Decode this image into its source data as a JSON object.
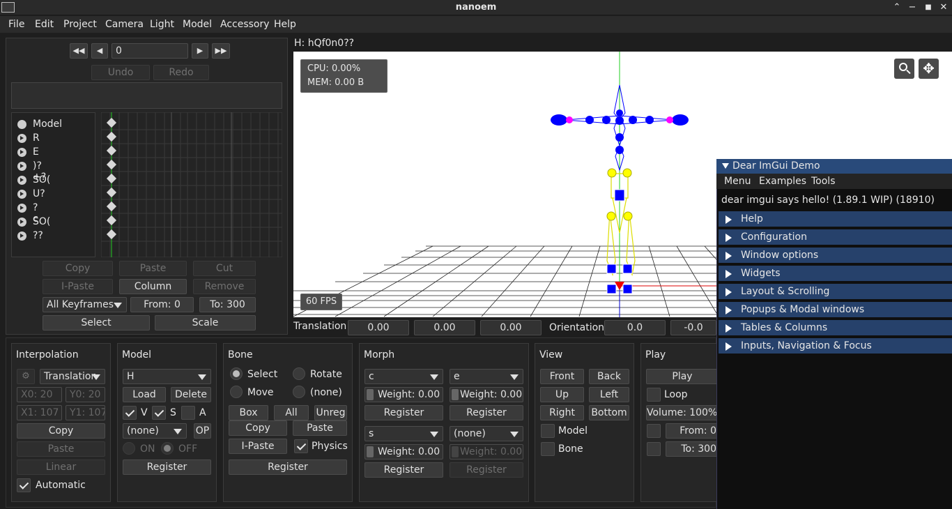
{
  "window": {
    "title": "nanoem",
    "minimize": "−",
    "maximize": "■",
    "close": "✕",
    "collapse": "⌃"
  },
  "menu": [
    "File",
    "Edit",
    "Project",
    "Camera",
    "Light",
    "Model",
    "Accessory",
    "Help"
  ],
  "timeline": {
    "frame_value": "0",
    "undo": "Undo",
    "redo": "Redo",
    "tracks": [
      {
        "label": "Model",
        "kind": "dot"
      },
      {
        "label": "R",
        "kind": "arrow"
      },
      {
        "label": "E",
        "kind": "arrow"
      },
      {
        "label": ")?+?",
        "kind": "arrow"
      },
      {
        "label": "SO(",
        "kind": "arrow"
      },
      {
        "label": "U?",
        "kind": "arrow"
      },
      {
        "label": "?c",
        "kind": "arrow"
      },
      {
        "label": "SO(",
        "kind": "arrow"
      },
      {
        "label": "??",
        "kind": "arrow"
      }
    ],
    "copy": "Copy",
    "paste": "Paste",
    "cut": "Cut",
    "ipaste": "I-Paste",
    "column": "Column",
    "remove": "Remove",
    "keyframes_select": "All Keyframes",
    "from": "From: 0",
    "to": "To: 300",
    "select": "Select",
    "scale": "Scale"
  },
  "viewport": {
    "header": "H: hQf0n0??",
    "cpu": "CPU: 0.00%",
    "mem": "MEM: 0.00 B",
    "fps": "60 FPS",
    "translation_label": "Translation",
    "translation": [
      "0.00",
      "0.00",
      "0.00"
    ],
    "orientation_label": "Orientation",
    "orientation": [
      "0.0",
      "-0.0"
    ]
  },
  "interpolation": {
    "title": "Interpolation",
    "mode": "Translation",
    "x0": "X0: 20",
    "y0": "Y0: 20",
    "x1": "X1: 107",
    "y1": "Y1: 107",
    "copy": "Copy",
    "paste": "Paste",
    "linear": "Linear",
    "automatic": "Automatic"
  },
  "model": {
    "title": "Model",
    "selected": "H",
    "load": "Load",
    "delete": "Delete",
    "v": "V",
    "s": "S",
    "a": "A",
    "op_select": "(none)",
    "op": "OP",
    "on": "ON",
    "off": "OFF",
    "register": "Register"
  },
  "bone": {
    "title": "Bone",
    "select": "Select",
    "rotate": "Rotate",
    "move": "Move",
    "none": "(none)",
    "box": "Box",
    "all": "All",
    "unreg": "Unreg",
    "copy": "Copy",
    "paste": "Paste",
    "ipaste": "I-Paste",
    "physics": "Physics",
    "register": "Register"
  },
  "morph": {
    "title": "Morph",
    "slots": [
      {
        "name": "c",
        "weight": "Weight: 0.00",
        "register": "Register"
      },
      {
        "name": "e",
        "weight": "Weight: 0.00",
        "register": "Register"
      },
      {
        "name": "s",
        "weight": "Weight: 0.00",
        "register": "Register"
      },
      {
        "name": "(none)",
        "weight": "Weight: 0.00",
        "register": "Register"
      }
    ]
  },
  "view": {
    "title": "View",
    "front": "Front",
    "back": "Back",
    "up": "Up",
    "left": "Left",
    "right": "Right",
    "bottom": "Bottom",
    "model": "Model",
    "bone": "Bone"
  },
  "play": {
    "title": "Play",
    "play": "Play",
    "loop": "Loop",
    "volume": "Volume: 100%",
    "from": "From: 0",
    "to": "To: 300"
  },
  "imgui": {
    "title": "Dear ImGui Demo",
    "menu": [
      "Menu",
      "Examples",
      "Tools"
    ],
    "hello": "dear imgui says hello! (1.89.1 WIP) (18910)",
    "headers": [
      "Help",
      "Configuration",
      "Window options",
      "Widgets",
      "Layout & Scrolling",
      "Popups & Modal windows",
      "Tables & Columns",
      "Inputs, Navigation & Focus"
    ]
  },
  "colors": {
    "accent": "#26416b",
    "bone_blue": "#0000ff",
    "ik_yellow": "#ffff00",
    "magenta": "#ff00ff"
  }
}
